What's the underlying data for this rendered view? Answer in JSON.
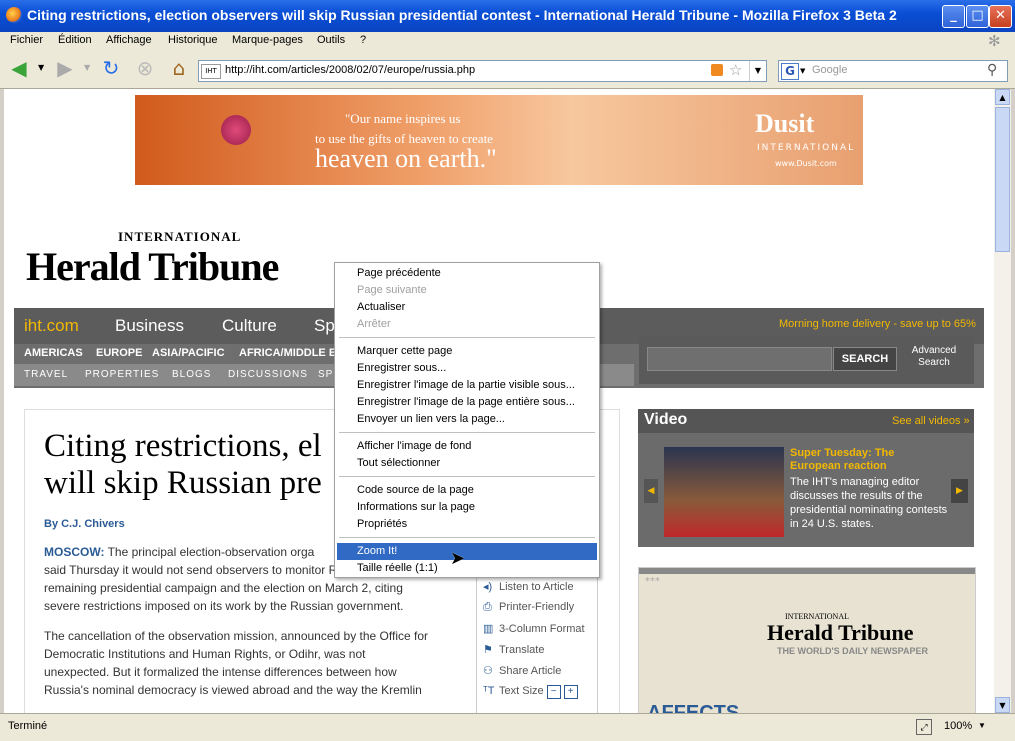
{
  "window": {
    "title": "Citing restrictions, election observers will skip Russian presidential contest - International Herald Tribune - Mozilla Firefox 3 Beta 2"
  },
  "menubar": [
    "Fichier",
    "Édition",
    "Affichage",
    "Historique",
    "Marque-pages",
    "Outils",
    "?"
  ],
  "navbar": {
    "url": "http://iht.com/articles/2008/02/07/europe/russia.php",
    "site_label": "IHT",
    "search_placeholder": "Google",
    "search_engine": "G"
  },
  "ad": {
    "line1": "\"Our name inspires us",
    "line2": "to use the gifts of heaven to create",
    "line3": "heaven on earth.\"",
    "brand": "Dusit",
    "brand_sub": "INTERNATIONAL",
    "brand_url": "www.Dusit.com"
  },
  "masthead": {
    "international": "INTERNATIONAL",
    "name": "Herald Tribune"
  },
  "nav": {
    "home": "iht.com",
    "main": [
      "Business",
      "Culture",
      "Sp"
    ],
    "promo": "Morning home delivery - save up to 65%",
    "regions": [
      "AMERICAS",
      "EUROPE",
      "ASIA/PACIFIC",
      "AFRICA/MIDDLE EA"
    ],
    "sections": [
      "TRAVEL",
      "PROPERTIES",
      "BLOGS",
      "DISCUSSIONS",
      "SP"
    ],
    "search_button": "SEARCH",
    "advanced": "Advanced Search"
  },
  "article": {
    "headline_line1": "Citing restrictions, el",
    "headline_line2": "will skip Russian pre",
    "byline": "By C.J. Chivers",
    "dateline": "MOSCOW:",
    "p1": " The principal election-observation orga",
    "p1_line2": "said Thursday it would not send observers to monitor Russia's",
    "p1_line3": "remaining presidential campaign and the election on March 2, citing",
    "p1_line4": "severe restrictions imposed on its work by the Russian government.",
    "p2_line1": "The cancellation of the observation mission, announced by the Office for",
    "p2_line2": "Democratic Institutions and Human Rights, or Odihr, was not",
    "p2_line3": "unexpected. But it formalized the intense differences between how",
    "p2_line4": "Russia's nominal democracy is viewed abroad and the way the Kremlin"
  },
  "tools": [
    "Listen to Article",
    "Printer-Friendly",
    "3-Column Format",
    "Translate",
    "Share Article",
    "Text Size"
  ],
  "video": {
    "heading": "Video",
    "see_all": "See all videos »",
    "title": "Super Tuesday: The European reaction",
    "desc": "The IHT's managing editor discusses the results of the presidential nominating contests in 24 U.S. states."
  },
  "promo2": {
    "stars": "***",
    "international": "INTERNATIONAL",
    "name": "Herald Tribune",
    "tagline": "THE WORLD'S DAILY NEWSPAPER",
    "bottom": "AFFECTS"
  },
  "context_menu": {
    "items": [
      {
        "label": "Page précédente",
        "state": "enabled"
      },
      {
        "label": "Page suivante",
        "state": "disabled"
      },
      {
        "label": "Actualiser",
        "state": "enabled"
      },
      {
        "label": "Arrêter",
        "state": "disabled"
      },
      {
        "label": "Marquer cette page",
        "state": "enabled"
      },
      {
        "label": "Enregistrer sous...",
        "state": "enabled"
      },
      {
        "label": "Enregistrer l'image de la partie visible sous...",
        "state": "enabled"
      },
      {
        "label": "Enregistrer l'image de la page entière sous...",
        "state": "enabled"
      },
      {
        "label": "Envoyer un lien vers la page...",
        "state": "enabled"
      },
      {
        "label": "Afficher l'image de fond",
        "state": "enabled"
      },
      {
        "label": "Tout sélectionner",
        "state": "enabled"
      },
      {
        "label": "Code source de la page",
        "state": "enabled"
      },
      {
        "label": "Informations sur la page",
        "state": "enabled"
      },
      {
        "label": "Propriétés",
        "state": "enabled"
      },
      {
        "label": "Zoom It!",
        "state": "highlighted"
      },
      {
        "label": "Taille réelle (1:1)",
        "state": "enabled"
      }
    ]
  },
  "status": {
    "text": "Terminé",
    "zoom": "100%"
  }
}
